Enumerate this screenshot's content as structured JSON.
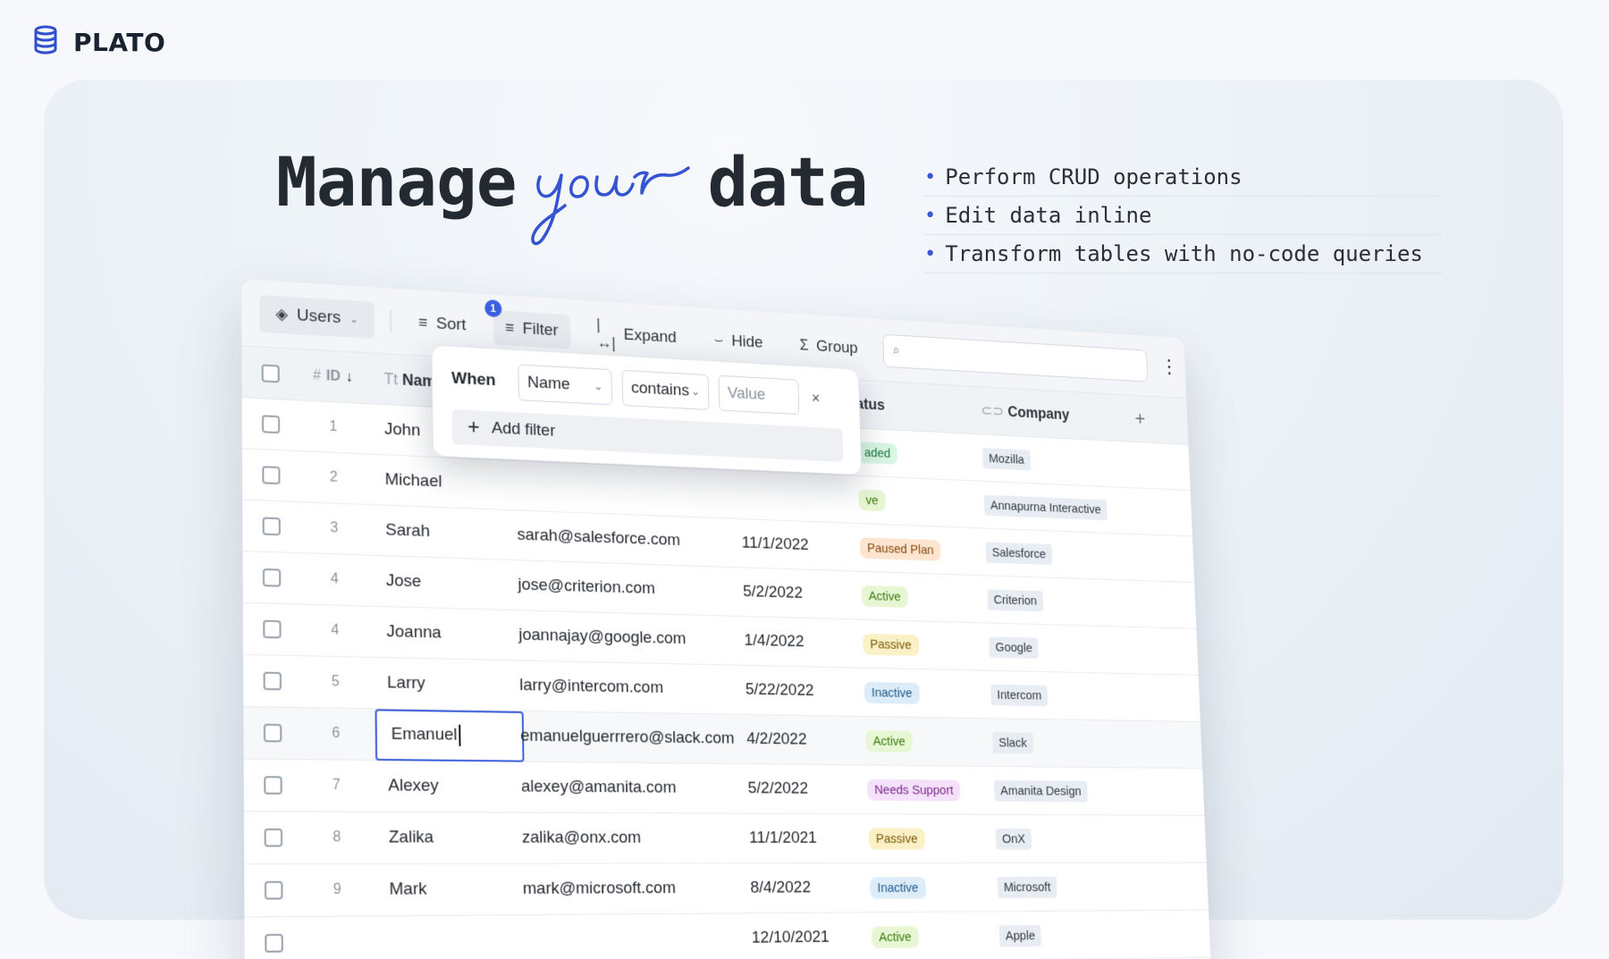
{
  "brand": {
    "name": "PLATO",
    "icon": "database-icon"
  },
  "hero": {
    "headline_left": "Manage",
    "headline_script": "your",
    "headline_right": "data",
    "bullets": [
      "Perform CRUD operations",
      "Edit data inline",
      "Transform tables with no-code queries"
    ],
    "accent_color": "#3858d6"
  },
  "toolbar": {
    "table_name": "Users",
    "sort_label": "Sort",
    "filter_label": "Filter",
    "filter_count": "1",
    "expand_label": "Expand",
    "hide_label": "Hide",
    "group_label": "Group",
    "search_placeholder": ""
  },
  "columns": {
    "id": "ID",
    "name": "Name",
    "status": "atus",
    "company": "Company",
    "add": "+"
  },
  "filter_popover": {
    "when_label": "When",
    "field": "Name",
    "operator": "contains",
    "value_placeholder": "Value",
    "close": "×",
    "add_filter_label": "Add filter"
  },
  "rows": [
    {
      "id": "1",
      "name": "John",
      "email": "",
      "date": "",
      "status": "aded",
      "status_color": "#d9f6e4",
      "status_text_color": "#1e7a46",
      "company": "Mozilla"
    },
    {
      "id": "2",
      "name": "Michael",
      "email": "",
      "date": "",
      "status": "ve",
      "status_color": "#e7f7d3",
      "status_text_color": "#3c7a12",
      "company": "Annapurna Interactive"
    },
    {
      "id": "3",
      "name": "Sarah",
      "email": "sarah@salesforce.com",
      "date": "11/1/2022",
      "status": "Paused Plan",
      "status_color": "#fde5cf",
      "status_text_color": "#8a4a12",
      "company": "Salesforce"
    },
    {
      "id": "4",
      "name": "Jose",
      "email": "jose@criterion.com",
      "date": "5/2/2022",
      "status": "Active",
      "status_color": "#e7f7d3",
      "status_text_color": "#3c7a12",
      "company": "Criterion"
    },
    {
      "id": "4",
      "name": "Joanna",
      "email": "joannajay@google.com",
      "date": "1/4/2022",
      "status": "Passive",
      "status_color": "#fbf0c6",
      "status_text_color": "#7a5a0a",
      "company": "Google"
    },
    {
      "id": "5",
      "name": "Larry",
      "email": "larry@intercom.com",
      "date": "5/22/2022",
      "status": "Inactive",
      "status_color": "#dcecf9",
      "status_text_color": "#1f5a8a",
      "company": "Intercom"
    },
    {
      "id": "6",
      "name": "Emanuel",
      "email": "emanuelguerrrero@slack.com",
      "date": "4/2/2022",
      "status": "Active",
      "status_color": "#e7f7d3",
      "status_text_color": "#3c7a12",
      "company": "Slack",
      "editing": true
    },
    {
      "id": "7",
      "name": "Alexey",
      "email": "alexey@amanita.com",
      "date": "5/2/2022",
      "status": "Needs Support",
      "status_color": "#f6e1fb",
      "status_text_color": "#7a2a8a",
      "company": "Amanita Design"
    },
    {
      "id": "8",
      "name": "Zalika",
      "email": "zalika@onx.com",
      "date": "11/1/2021",
      "status": "Passive",
      "status_color": "#fbf0c6",
      "status_text_color": "#7a5a0a",
      "company": "OnX"
    },
    {
      "id": "9",
      "name": "Mark",
      "email": "mark@microsoft.com",
      "date": "8/4/2022",
      "status": "Inactive",
      "status_color": "#dcecf9",
      "status_text_color": "#1f5a8a",
      "company": "Microsoft"
    },
    {
      "id": "",
      "name": "",
      "email": "",
      "date": "12/10/2021",
      "status": "Active",
      "status_color": "#e7f7d3",
      "status_text_color": "#3c7a12",
      "company": "Apple"
    }
  ]
}
